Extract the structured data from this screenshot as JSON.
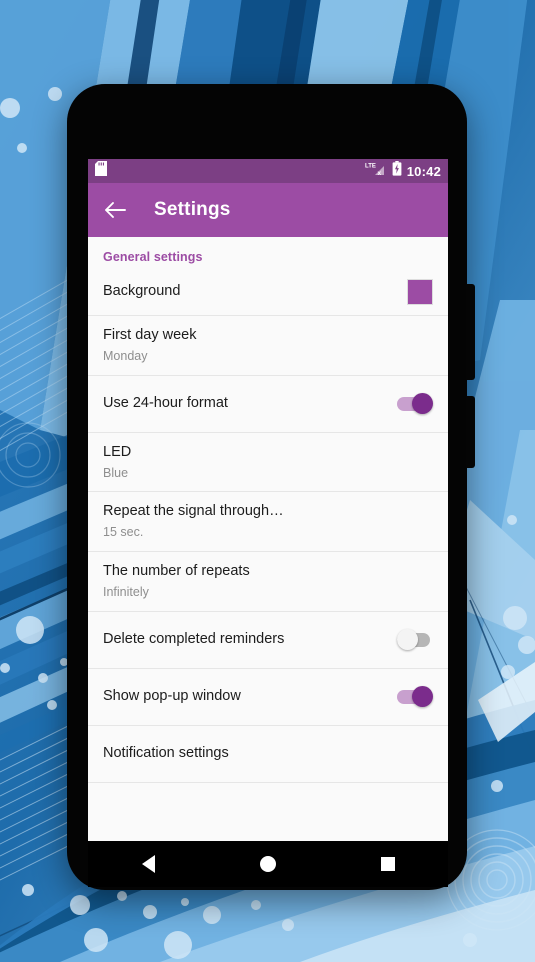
{
  "wallpaper": {
    "description": "blue-abstract-rays-bubbles",
    "colors": {
      "deep_blue": "#0f4f84",
      "mid_blue": "#2f7fc0",
      "light_blue": "#74b4e4",
      "pale_blue": "#a9d3f0",
      "white_band": "#eaf4fc"
    }
  },
  "theme": {
    "status_bar_color": "#7c3f84",
    "app_bar_color": "#9c4ca4",
    "accent_color": "#9c4ca4",
    "toggle_on_thumb": "#7b2c8c",
    "toggle_on_track": "#c8a0ce",
    "toggle_off_thumb": "#f4f4f4",
    "toggle_off_track": "#b6b6b6",
    "list_background": "#fafafa",
    "divider_color": "#e6e6e6"
  },
  "status_bar": {
    "sd_card_icon": "sd-card-icon",
    "signal_icon": "lte-signal-no-service-icon",
    "signal_label": "LTE",
    "signal_cross_label": "x",
    "battery_icon": "battery-charging-icon",
    "clock": "10:42"
  },
  "app_bar": {
    "back_icon": "arrow-back-icon",
    "title": "Settings"
  },
  "settings": {
    "section_header": "General settings",
    "rows": [
      {
        "name": "background",
        "title": "Background",
        "subtitle": "",
        "accessory": "color-swatch",
        "swatch_color": "#9c4ca4"
      },
      {
        "name": "first-day-week",
        "title": "First day week",
        "subtitle": "Monday",
        "accessory": "none"
      },
      {
        "name": "use-24-hour-format",
        "title": "Use 24-hour format",
        "subtitle": "",
        "accessory": "toggle",
        "toggle_state": "on"
      },
      {
        "name": "led",
        "title": "LED",
        "subtitle": "Blue",
        "accessory": "none"
      },
      {
        "name": "repeat-the-signal-through",
        "title": "Repeat the signal through…",
        "subtitle": "15 sec.",
        "accessory": "none"
      },
      {
        "name": "the-number-of-repeats",
        "title": "The number of repeats",
        "subtitle": "Infinitely",
        "accessory": "none"
      },
      {
        "name": "delete-completed-reminders",
        "title": "Delete completed reminders",
        "subtitle": "",
        "accessory": "toggle",
        "toggle_state": "off"
      },
      {
        "name": "show-pop-up-window",
        "title": "Show pop-up window",
        "subtitle": "",
        "accessory": "toggle",
        "toggle_state": "on"
      },
      {
        "name": "notification-settings",
        "title": "Notification settings",
        "subtitle": "",
        "accessory": "none"
      }
    ]
  },
  "nav_bar": {
    "back_icon": "nav-back-triangle-icon",
    "home_icon": "nav-home-circle-icon",
    "recents_icon": "nav-recents-square-icon"
  }
}
